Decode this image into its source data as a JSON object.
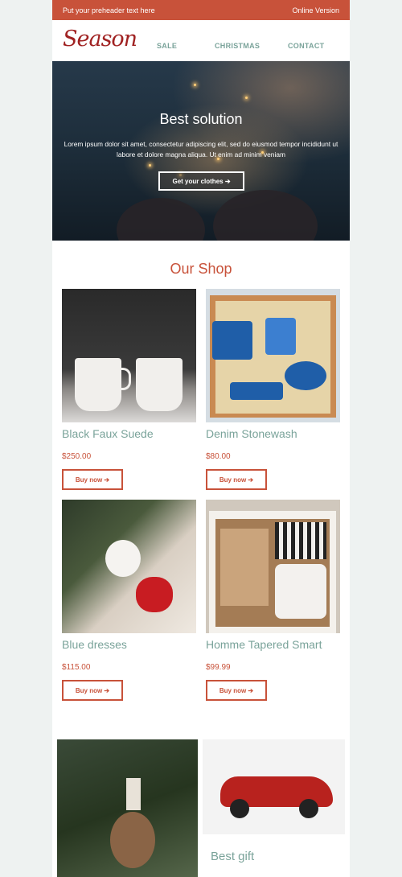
{
  "preheader": {
    "text": "Put your preheader text here",
    "online": "Online Version"
  },
  "header": {
    "logo": "Season",
    "nav": [
      "SALE",
      "CHRISTMAS",
      "CONTACT"
    ]
  },
  "hero": {
    "title": "Best solution",
    "text": "Lorem ipsum dolor sit amet, consectetur adipiscing elit, sed do eiusmod tempor incididunt ut labore et dolore magna aliqua. Ut enim ad minim veniam",
    "button": "Get your clothes ➔"
  },
  "shop": {
    "title": "Our Shop",
    "products": [
      {
        "name": "Black Faux Suede",
        "price": "$250.00",
        "button": "Buy now ➔"
      },
      {
        "name": "Denim Stonewash",
        "price": "$80.00",
        "button": "Buy now ➔"
      },
      {
        "name": "Blue dresses",
        "price": "$115.00",
        "button": "Buy now ➔"
      },
      {
        "name": "Homme Tapered Smart",
        "price": "$99.99",
        "button": "Buy now ➔"
      }
    ]
  },
  "feature": {
    "title": "Best gift"
  },
  "colors": {
    "accent": "#c8523a",
    "teal": "#7aa39a",
    "logo": "#a02222",
    "background": "#eef2f1"
  },
  "images": {
    "hero": "sparklers-photo",
    "p1": "mugs-photo",
    "p2": "gift-box-photo",
    "p3": "red-mug-photo",
    "p4": "cocoa-box-photo",
    "b1": "pinecone-ornament-photo",
    "b2": "red-car-toy-photo"
  }
}
